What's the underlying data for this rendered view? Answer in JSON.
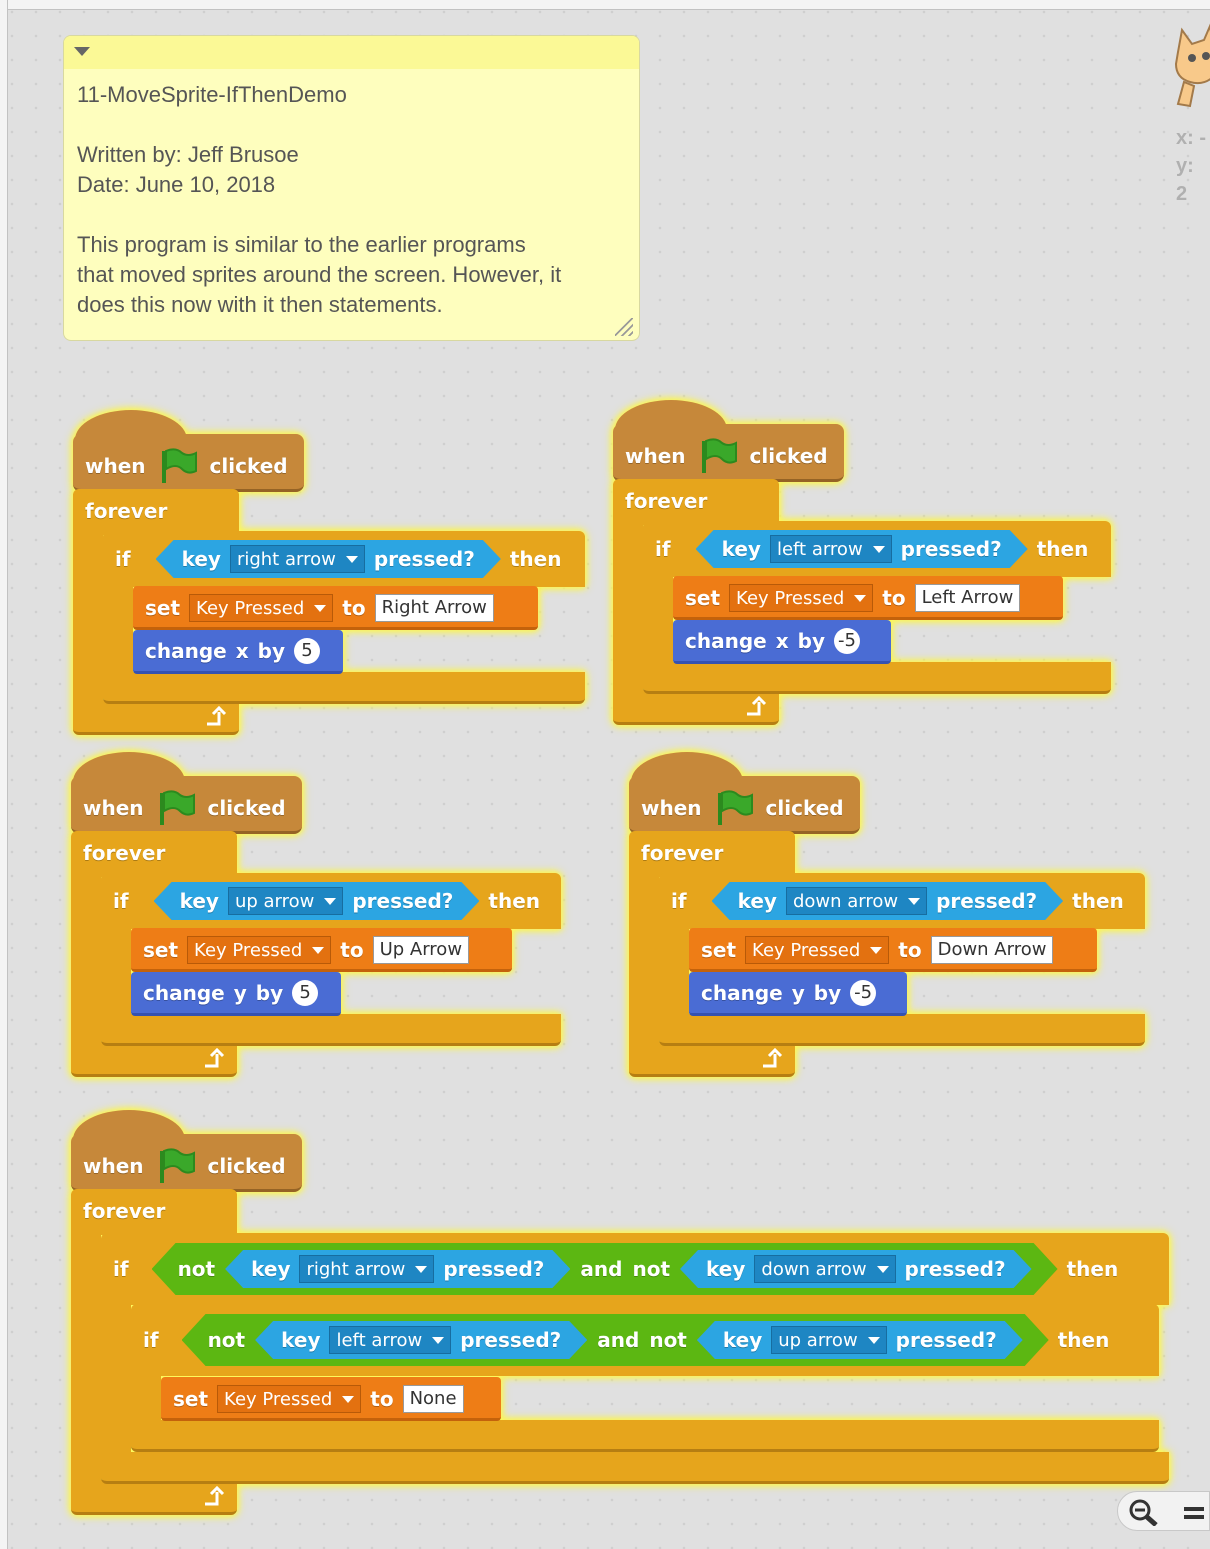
{
  "comment": {
    "lines": [
      "11-MoveSprite-IfThenDemo",
      "",
      "Written by: Jeff Brusoe",
      "Date: June 10, 2018",
      "",
      "This program is similar to the earlier programs",
      "that moved sprites around the screen. However, it",
      "does this now with it then statements."
    ]
  },
  "sprite_coords": {
    "x_label": "x:",
    "x_value": "-",
    "y_label": "y:",
    "y_value": "2"
  },
  "blocks": {
    "when": "when",
    "clicked": "clicked",
    "forever": "forever",
    "if": "if",
    "then": "then",
    "key": "key",
    "pressed": "pressed?",
    "set": "set",
    "to": "to",
    "change": "change",
    "by": "by",
    "x": "x",
    "y": "y",
    "not": "not",
    "and": "and",
    "variable": "Key Pressed"
  },
  "scripts": [
    {
      "key": "right arrow",
      "value": "Right Arrow",
      "axis": "x",
      "amount": "5"
    },
    {
      "key": "left arrow",
      "value": "Left Arrow",
      "axis": "x",
      "amount": "-5"
    },
    {
      "key": "up arrow",
      "value": "Up Arrow",
      "axis": "y",
      "amount": "5"
    },
    {
      "key": "down arrow",
      "value": "Down Arrow",
      "axis": "y",
      "amount": "-5"
    }
  ],
  "script5": {
    "outer_keys": [
      "right arrow",
      "down arrow"
    ],
    "inner_keys": [
      "left arrow",
      "up arrow"
    ],
    "value": "None"
  },
  "colors": {
    "events": "#c6883a",
    "control": "#e6a51c",
    "sensing": "#2ca5e2",
    "data": "#ee7d16",
    "motion": "#4a6cd4",
    "operators": "#5cb712",
    "glow": "#fffb60"
  },
  "icons": [
    "green-flag-icon",
    "loop-arrow-icon",
    "dropdown-arrow-icon",
    "zoom-out-icon",
    "zoom-reset-icon",
    "scratch-cat-sprite"
  ]
}
